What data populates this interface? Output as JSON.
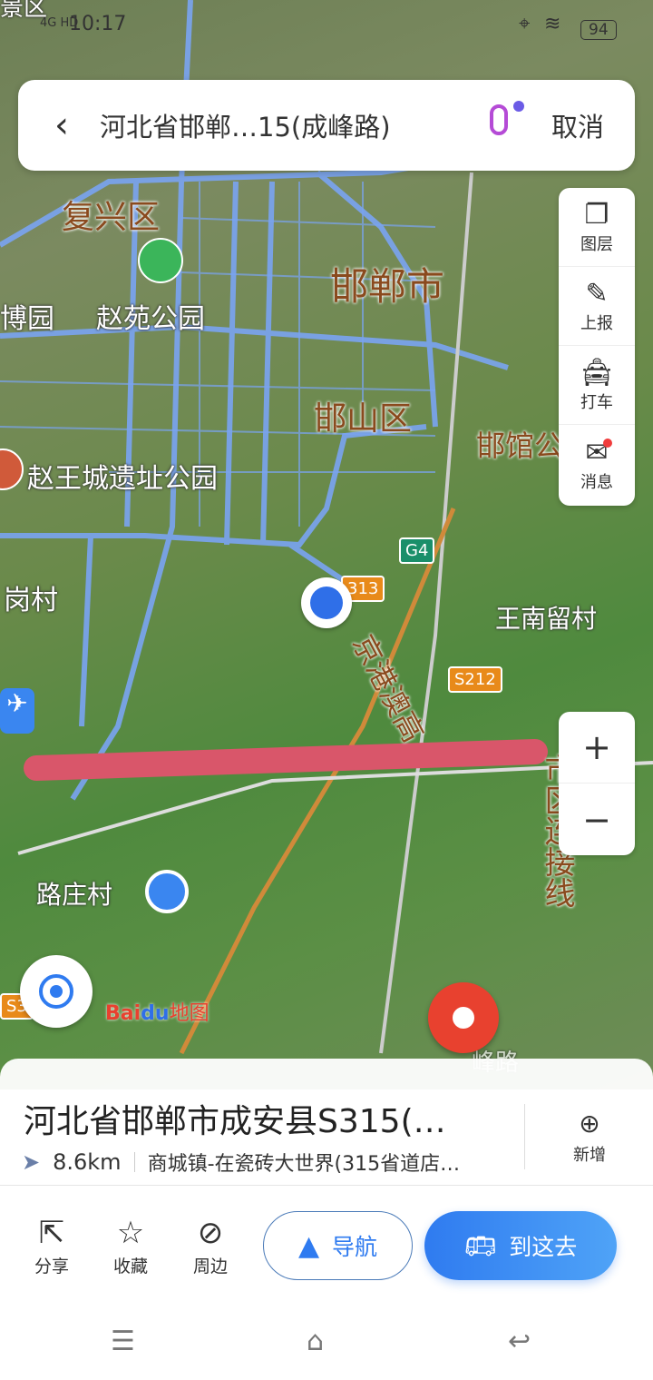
{
  "status": {
    "network": "4G HD",
    "time": "10:17",
    "battery": "94"
  },
  "search": {
    "query": "河北省邯郸…15(成峰路)",
    "cancel": "取消",
    "back_icon": "chevron-left-icon",
    "mic_icon": "microphone-icon"
  },
  "tools": [
    {
      "label": "图层",
      "icon": "layers-icon"
    },
    {
      "label": "上报",
      "icon": "edit-icon"
    },
    {
      "label": "打车",
      "icon": "taxi-icon"
    },
    {
      "label": "消息",
      "icon": "mail-icon"
    }
  ],
  "zoom": {
    "in": "+",
    "out": "−"
  },
  "map": {
    "labels": [
      "景区",
      "复兴区",
      "赵苑公园",
      "博园",
      "邯郸市",
      "邯山区",
      "邯馆公",
      "赵王城遗址公园",
      "岗村",
      "王南留村",
      "京港澳高",
      "市区连接线",
      "路庄村",
      "峰路"
    ],
    "shields": [
      "G4",
      "313",
      "S212",
      "S3"
    ],
    "logo": "Bai du 地图"
  },
  "place": {
    "title": "河北省邯郸市成安县S315(…",
    "distance": "8.6km",
    "address": "商城镇-在瓷砖大世界(315省道店…",
    "add_label": "新增"
  },
  "actions": [
    {
      "label": "分享",
      "icon": "share-icon"
    },
    {
      "label": "收藏",
      "icon": "star-icon"
    },
    {
      "label": "周边",
      "icon": "compass-icon"
    }
  ],
  "nav_label": "导航",
  "go_label": "到这去",
  "colors": {
    "accent": "#2f7bf0",
    "road": "#6f9ef5",
    "highlight": "#d9566a",
    "pin": "#e8412f"
  }
}
